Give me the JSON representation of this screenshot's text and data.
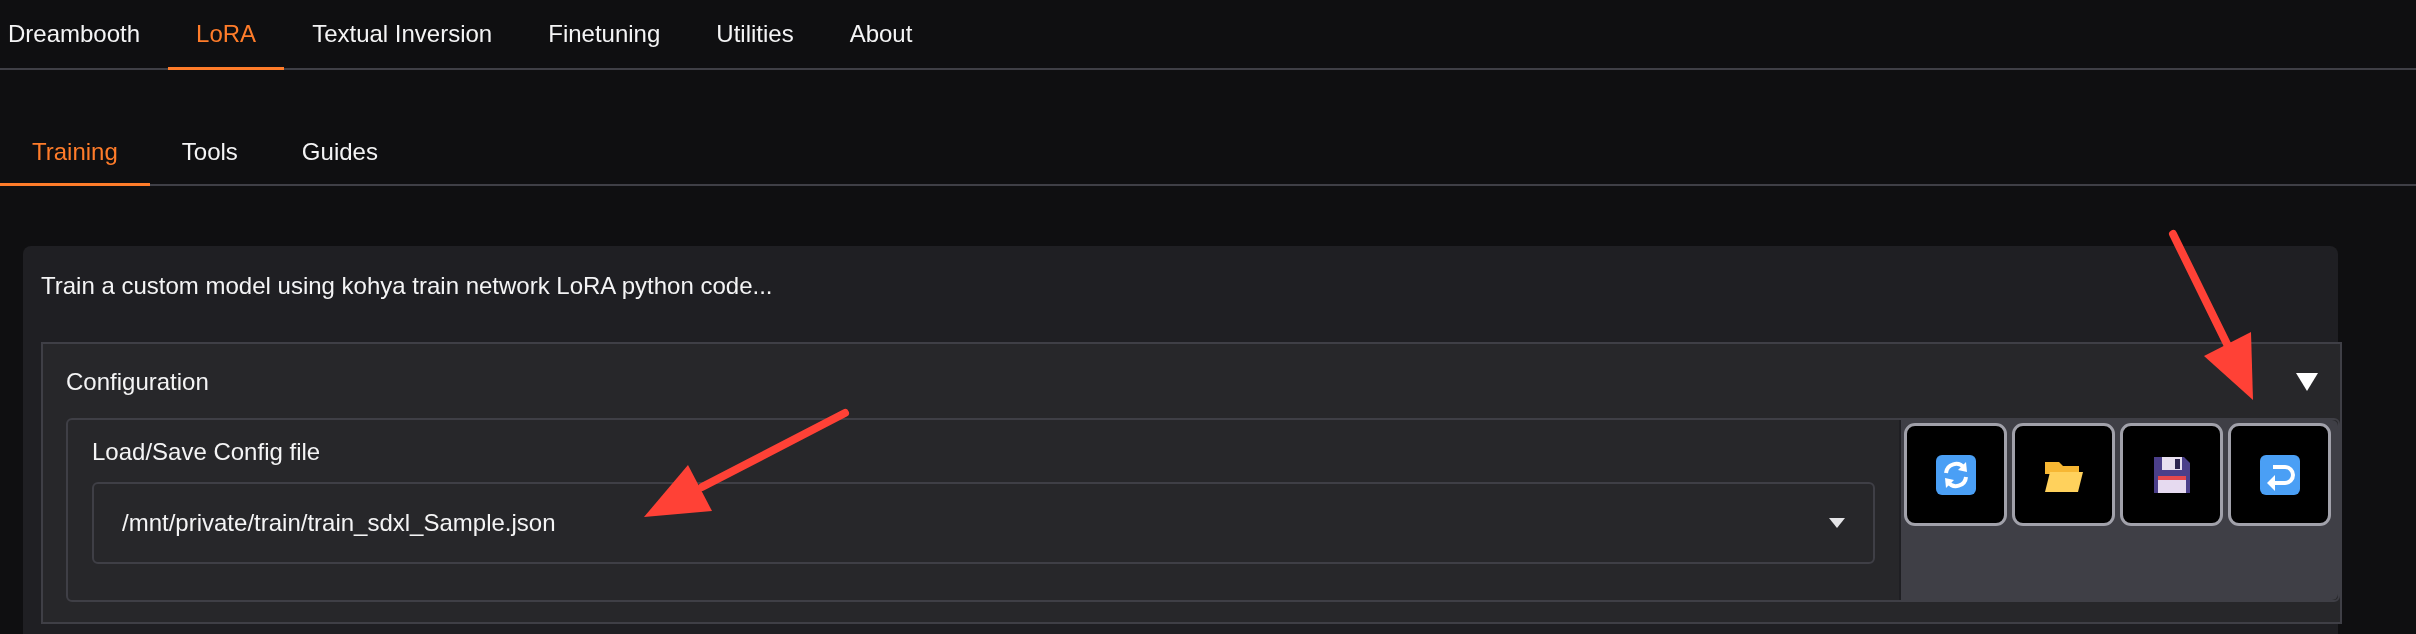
{
  "main_tabs": [
    {
      "label": "Dreambooth",
      "selected": false
    },
    {
      "label": "LoRA",
      "selected": true
    },
    {
      "label": "Textual Inversion",
      "selected": false
    },
    {
      "label": "Finetuning",
      "selected": false
    },
    {
      "label": "Utilities",
      "selected": false
    },
    {
      "label": "About",
      "selected": false
    }
  ],
  "sub_tabs": [
    {
      "label": "Training",
      "selected": true
    },
    {
      "label": "Tools",
      "selected": false
    },
    {
      "label": "Guides",
      "selected": false
    }
  ],
  "description": "Train a custom model using kohya train network LoRA python code...",
  "configuration": {
    "title": "Configuration",
    "expanded": true,
    "field_label": "Load/Save Config file",
    "dropdown": {
      "value": "/mnt/private/train/train_sdxl_Sample.json"
    },
    "buttons": [
      {
        "kind": "refresh"
      },
      {
        "kind": "open"
      },
      {
        "kind": "save"
      },
      {
        "kind": "load"
      }
    ]
  },
  "annotations": [
    {
      "kind": "arrow"
    },
    {
      "kind": "arrow"
    }
  ]
}
